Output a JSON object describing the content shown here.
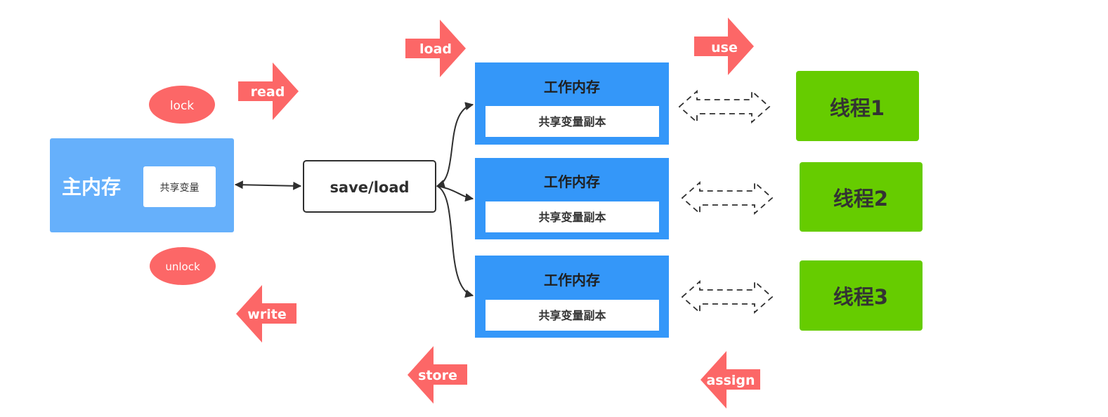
{
  "colors": {
    "main_memory": "#66b0fb",
    "work_memory": "#3497f9",
    "thread": "#66cc00",
    "op_arrow": "#fc6767",
    "white": "#ffffff",
    "dark_text": "#333333",
    "connector": "#2f2f2f"
  },
  "main_memory": {
    "title": "主内存",
    "variable": "共享变量"
  },
  "hub": {
    "label": "save/load"
  },
  "operations": {
    "lock": "lock",
    "unlock": "unlock",
    "read": "read",
    "write": "write",
    "load": "load",
    "store": "store",
    "use": "use",
    "assign": "assign"
  },
  "work_memories": [
    {
      "title": "工作内存",
      "copy": "共享变量副本"
    },
    {
      "title": "工作内存",
      "copy": "共享变量副本"
    },
    {
      "title": "工作内存",
      "copy": "共享变量副本"
    }
  ],
  "threads": [
    {
      "label": "线程1"
    },
    {
      "label": "线程2"
    },
    {
      "label": "线程3"
    }
  ]
}
